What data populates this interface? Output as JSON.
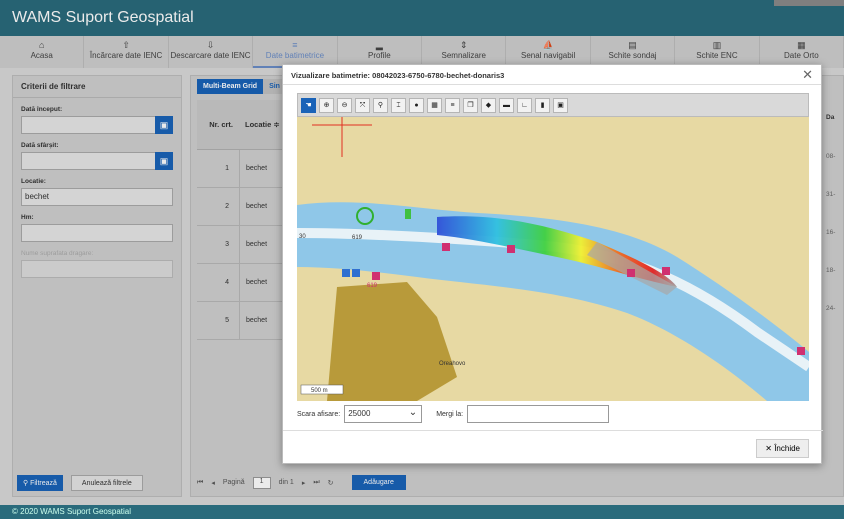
{
  "app": {
    "title": "WAMS Suport Geospatial",
    "footer": "© 2020 WAMS Suport Geospatial"
  },
  "nav": [
    {
      "label": "Acasa",
      "icon": "home-icon",
      "glyph": "⌂"
    },
    {
      "label": "Încărcare date IENC",
      "icon": "upload-icon",
      "glyph": "⇧"
    },
    {
      "label": "Descarcare date IENC",
      "icon": "download-icon",
      "glyph": "⇩"
    },
    {
      "label": "Date batimetrice",
      "icon": "list-icon",
      "glyph": "≡"
    },
    {
      "label": "Profile",
      "icon": "profile-icon",
      "glyph": "▂"
    },
    {
      "label": "Semnalizare",
      "icon": "signal-icon",
      "glyph": "⇕"
    },
    {
      "label": "Senal navigabil",
      "icon": "channel-icon",
      "glyph": "⛵"
    },
    {
      "label": "Schite sondaj",
      "icon": "sketch-icon",
      "glyph": "▤"
    },
    {
      "label": "Schite ENC",
      "icon": "map-icon",
      "glyph": "▥"
    },
    {
      "label": "Date Orto",
      "icon": "ortho-icon",
      "glyph": "▦"
    }
  ],
  "filter": {
    "title": "Criterii de filtrare",
    "start_label": "Dată început:",
    "end_label": "Dată sfârșit:",
    "location_label": "Locatie:",
    "location_value": "bechet",
    "km_label": "Hm:",
    "surface_label": "Nume suprafata dragare:",
    "filter_button": "Filtrează",
    "cancel_button": "Anulează filtrele"
  },
  "table": {
    "tabs": [
      "Multi-Beam Grid",
      "Sin"
    ],
    "col_nr": "Nr. crt.",
    "col_loc": "Locatie ≑",
    "rows": [
      {
        "nr": "1",
        "loc": "bechet",
        "date": "08-"
      },
      {
        "nr": "2",
        "loc": "bechet",
        "date": "31-"
      },
      {
        "nr": "3",
        "loc": "bechet",
        "date": "16-"
      },
      {
        "nr": "4",
        "loc": "bechet",
        "date": "18-"
      },
      {
        "nr": "5",
        "loc": "bechet",
        "date": "24-"
      }
    ],
    "right_header": "Da",
    "pager": {
      "page_label": "Pagină",
      "page": "1",
      "of": "din 1",
      "add_button": "Adăugare"
    }
  },
  "modal": {
    "title": "Vizualizare batimetrie: 08042023-6750-6780-bechet-donaris3",
    "scale_label": "Scara afisare:",
    "scale_value": "25000",
    "goto_label": "Mergi la:",
    "close_button": "Închide",
    "map": {
      "town": "Oreahovo",
      "scale_bar": "500 m",
      "depth_label": "619",
      "side_label": "30"
    }
  }
}
